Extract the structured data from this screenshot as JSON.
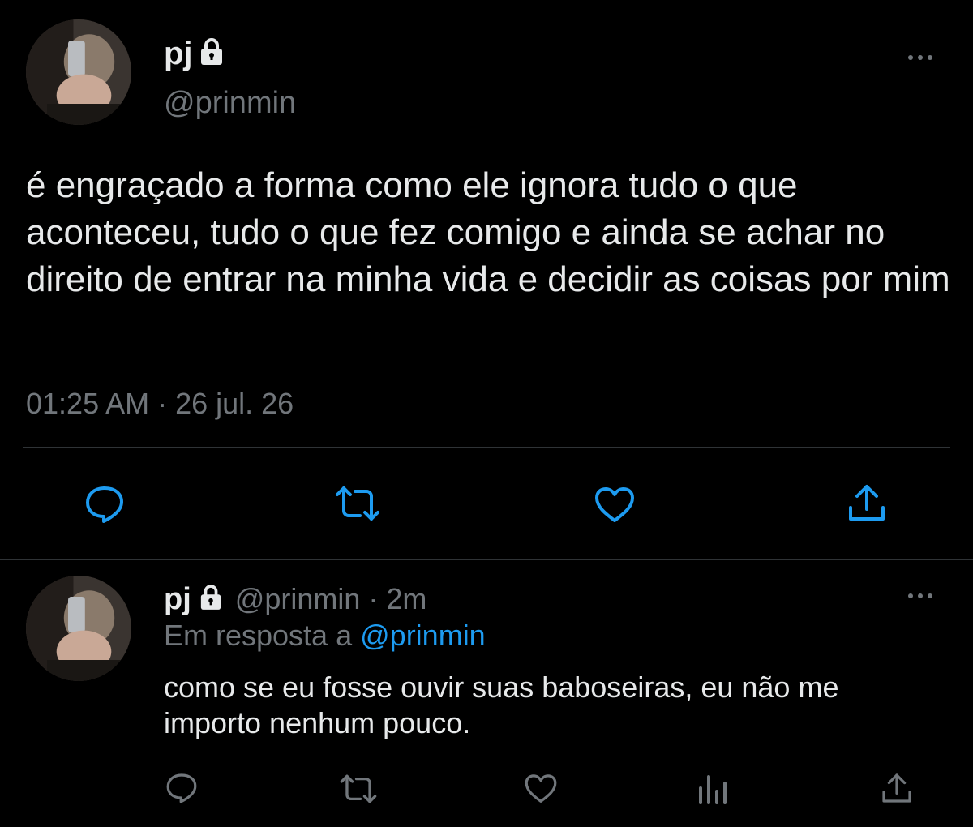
{
  "main_tweet": {
    "display_name": "pj",
    "handle": "@prinmin",
    "text": "é engraçado a forma como ele ignora tudo o que aconteceu, tudo o que fez comigo e ainda se achar no direito de entrar na minha vida e decidir as coisas por mim",
    "timestamp": "01:25 AM · 26 jul. 26",
    "icons": [
      "lock-icon",
      "more-icon",
      "reply-icon",
      "retweet-icon",
      "like-icon",
      "share-icon"
    ]
  },
  "reply_tweet": {
    "display_name": "pj",
    "handle_time": "@prinmin · 2m",
    "replying_prefix": "Em resposta a",
    "replying_to": "@prinmin",
    "text": "como se eu fosse ouvir suas baboseiras, eu não me importo nenhum pouco.",
    "icons": [
      "lock-icon",
      "more-icon",
      "reply-icon",
      "retweet-icon",
      "like-icon",
      "views-icon",
      "share-icon"
    ]
  },
  "colors": {
    "background": "#000000",
    "text": "#e7e9ea",
    "muted": "#71767b",
    "link": "#1d9bf0",
    "divider": "#2f3336"
  }
}
